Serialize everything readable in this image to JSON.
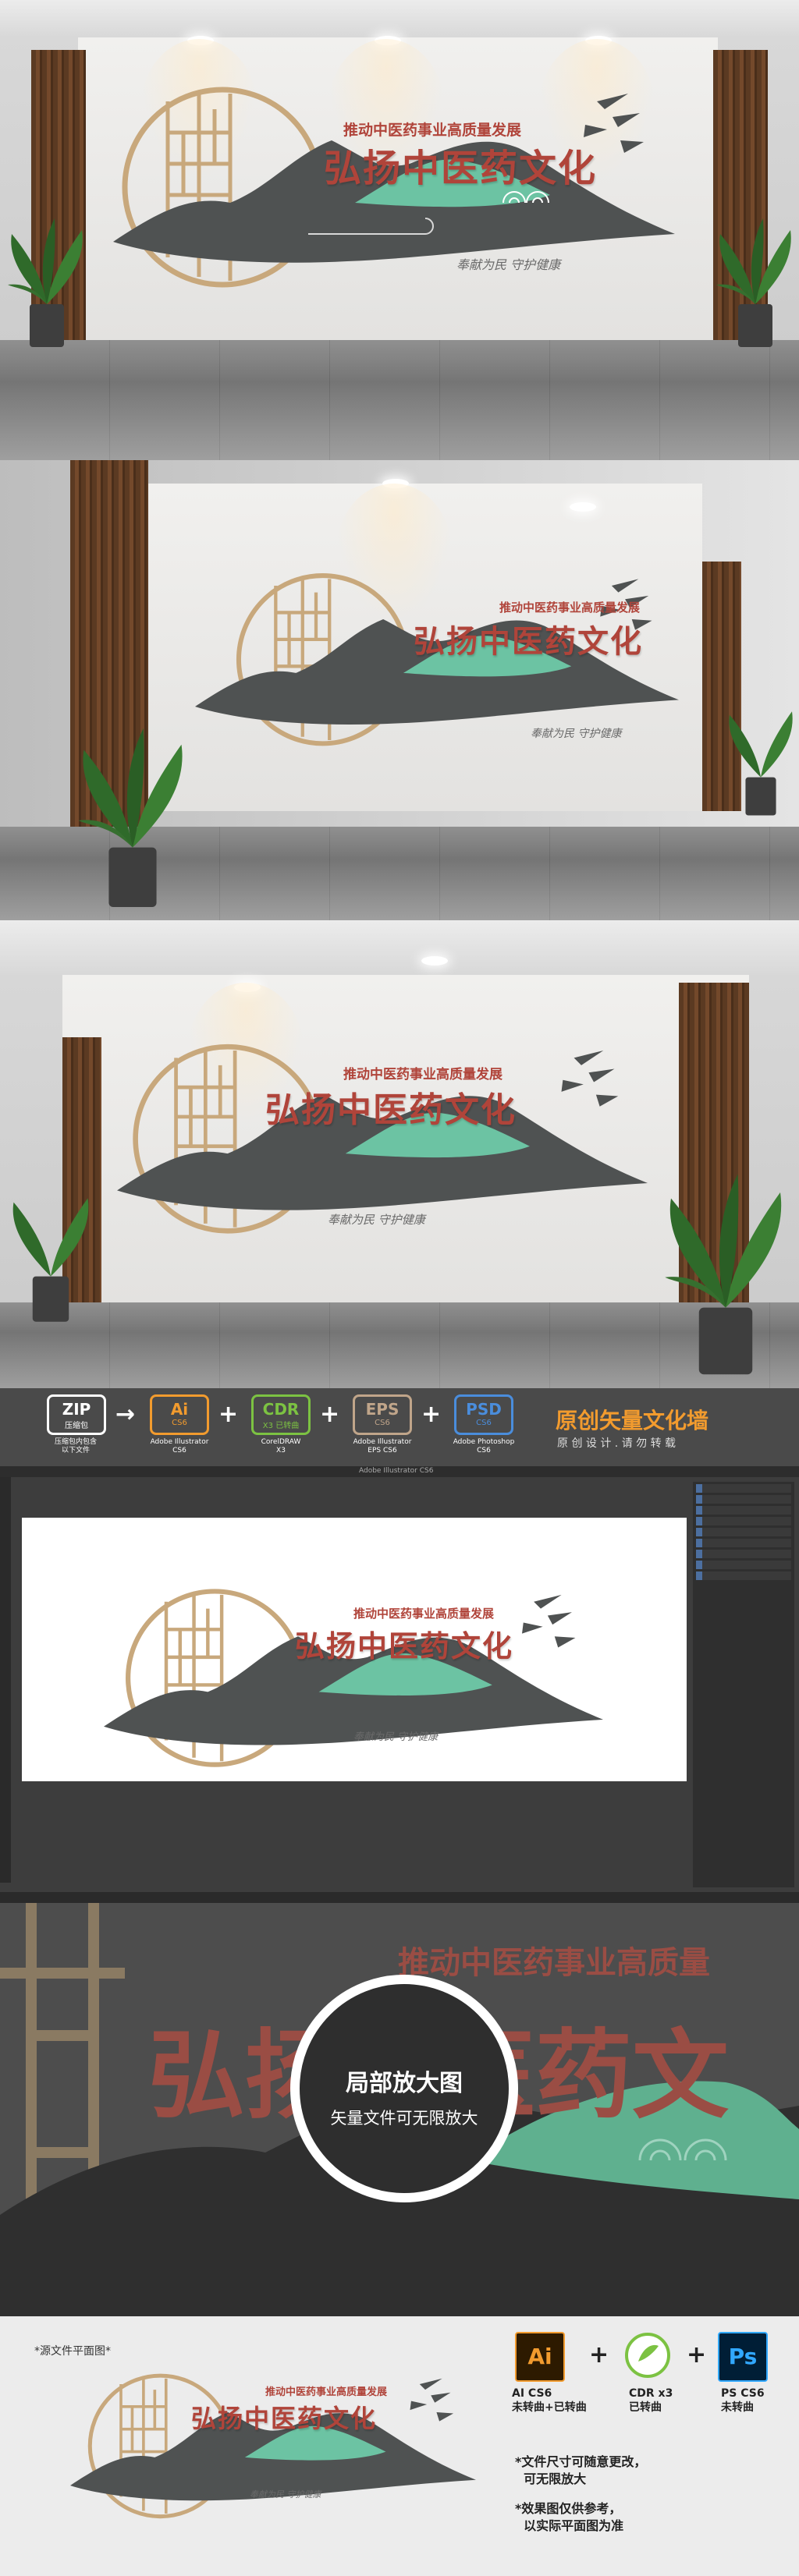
{
  "logo": {
    "subtitle": "推动中医药事业高质量发展",
    "title": "弘扬中医药文化",
    "slogan": "奉献为民    守护健康",
    "colors": {
      "red": "#b0443a",
      "gray": "#4f5252",
      "green": "#6cc3a3",
      "gold": "#c8a87c"
    }
  },
  "banner": {
    "zip": {
      "title": "ZIP",
      "sub": "压缩包",
      "caption": "压缩包内包含\n以下文件"
    },
    "formats": [
      {
        "title": "Ai",
        "version": "CS6",
        "note": "已转曲 未转曲",
        "caption": "Adobe Illustrator\nCS6",
        "color": "#f29b2e"
      },
      {
        "title": "CDR",
        "version": "X3 已转曲",
        "note": "",
        "caption": "CorelDRAW\nX3",
        "color": "#7cc242"
      },
      {
        "title": "EPS",
        "version": "CS6",
        "note": "",
        "caption": "Adobe Illustrator\nEPS CS6",
        "color": "#c0a58a"
      },
      {
        "title": "PSD",
        "version": "CS6",
        "note": "",
        "caption": "Adobe Photoshop\nCS6",
        "color": "#4a8ddc"
      }
    ],
    "headline": "原创矢量文化墙",
    "tagline": "原 创 设 计 . 请 勿 转 载"
  },
  "software": {
    "window_title": "Adobe Illustrator CS6"
  },
  "zoom": {
    "big_subtitle": "推动中医药事业高质量",
    "big_title": "弘扬中医药文",
    "circle_title": "局部放大图",
    "circle_sub": "矢量文件可无限放大"
  },
  "footer": {
    "label": "*源文件平面图*",
    "icons": [
      {
        "glyph": "Ai",
        "caption": "AI CS6\n未转曲+已转曲",
        "color": "#f29b2e",
        "bg": "#2d1a00"
      },
      {
        "glyph": "",
        "caption": "CDR x3\n已转曲",
        "color": "#7cc242",
        "bg": "#ffffff"
      },
      {
        "glyph": "Ps",
        "caption": "PS CS6\n未转曲",
        "color": "#31a8ff",
        "bg": "#001e36"
      }
    ],
    "notes": [
      "*文件尺寸可随意更改，",
      "  可无限放大",
      "*效果图仅供参考，",
      "  以实际平面图为准"
    ]
  }
}
